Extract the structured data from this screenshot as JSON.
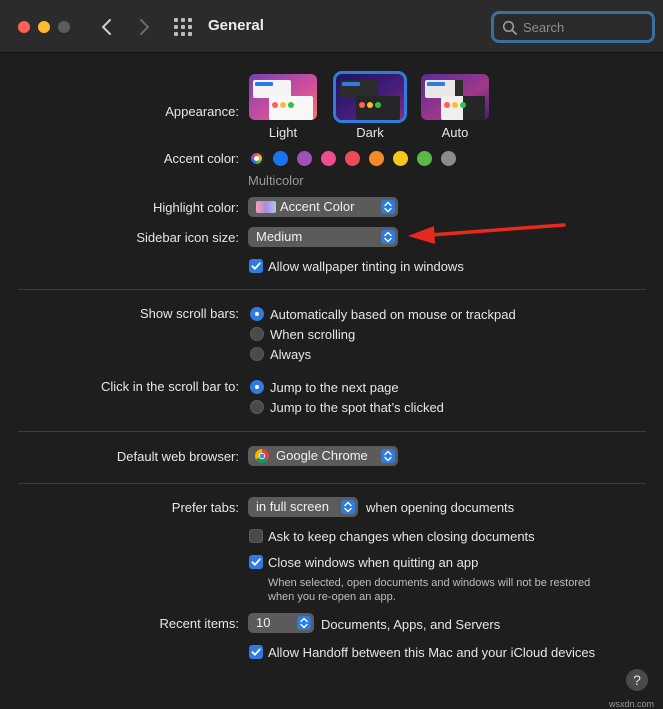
{
  "window": {
    "title": "General"
  },
  "search": {
    "placeholder": "Search"
  },
  "appearance": {
    "label": "Appearance:",
    "options": [
      "Light",
      "Dark",
      "Auto"
    ],
    "selected": "Dark"
  },
  "accent": {
    "label": "Accent color:",
    "caption": "Multicolor",
    "swatches": [
      "multicolor",
      "#1a73f0",
      "#a050b8",
      "#ec4e90",
      "#ec4c57",
      "#f28b25",
      "#f6c719",
      "#5cb948",
      "#8c8c8c"
    ]
  },
  "highlight": {
    "label": "Highlight color:",
    "value": "Accent Color"
  },
  "sidebar_icon": {
    "label": "Sidebar icon size:",
    "value": "Medium"
  },
  "wallpaper_tinting": {
    "label": "Allow wallpaper tinting in windows",
    "checked": true
  },
  "scroll_bars": {
    "label": "Show scroll bars:",
    "options": [
      "Automatically based on mouse or trackpad",
      "When scrolling",
      "Always"
    ],
    "selected_index": 0
  },
  "click_scroll": {
    "label": "Click in the scroll bar to:",
    "options": [
      "Jump to the next page",
      "Jump to the spot that’s clicked"
    ],
    "selected_index": 0
  },
  "browser": {
    "label": "Default web browser:",
    "value": "Google Chrome"
  },
  "tabs": {
    "label": "Prefer tabs:",
    "value": "in full screen",
    "suffix": "when opening documents"
  },
  "ask_keep": {
    "label": "Ask to keep changes when closing documents",
    "checked": false
  },
  "close_windows": {
    "label": "Close windows when quitting an app",
    "checked": true,
    "note_line1": "When selected, open documents and windows will not be restored",
    "note_line2": "when you re-open an app."
  },
  "recent": {
    "label": "Recent items:",
    "value": "10",
    "suffix": "Documents, Apps, and Servers"
  },
  "handoff": {
    "label": "Allow Handoff between this Mac and your iCloud devices",
    "checked": true
  },
  "help": {
    "glyph": "?"
  },
  "watermark": "wsxdn.com",
  "colors": {
    "accent": "#2f7ce0",
    "arrow": "#e8291c",
    "window_bg": "#1e1e1e"
  }
}
